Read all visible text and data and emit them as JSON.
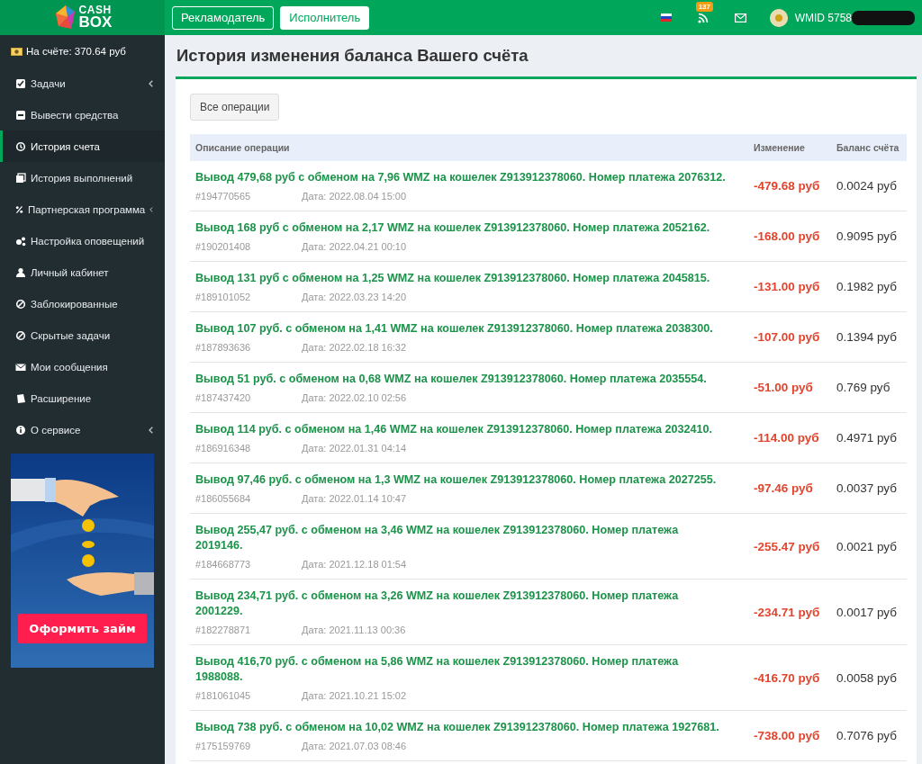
{
  "logo": {
    "line1": "CASH",
    "line2": "BOX"
  },
  "role_tabs": [
    {
      "label": "Рекламодатель",
      "selected": false
    },
    {
      "label": "Исполнитель",
      "selected": true
    }
  ],
  "topbar": {
    "notifications_count": "137",
    "user": "WMID 5758"
  },
  "sidebar": {
    "balance": "На счёте: 370.64 руб",
    "items": [
      {
        "label": "Задачи",
        "kind": "submenu",
        "selected": false
      },
      {
        "label": "Вывести средства",
        "kind": "link",
        "selected": false
      },
      {
        "label": "История счета",
        "kind": "link",
        "selected": true
      },
      {
        "label": "История выполнений",
        "kind": "link",
        "selected": false
      },
      {
        "label": "Партнерская программа",
        "kind": "submenu",
        "selected": false
      },
      {
        "label": "Настройка оповещений",
        "kind": "link",
        "selected": false
      },
      {
        "label": "Личный кабинет",
        "kind": "link",
        "selected": false
      },
      {
        "label": "Заблокированные",
        "kind": "link",
        "selected": false
      },
      {
        "label": "Скрытые задачи",
        "kind": "link",
        "selected": false
      },
      {
        "label": "Мои сообщения",
        "kind": "link",
        "selected": false
      },
      {
        "label": "Расширение",
        "kind": "link",
        "selected": false
      },
      {
        "label": "О сервисе",
        "kind": "submenu",
        "selected": false
      }
    ],
    "ad": {
      "button": "Оформить займ"
    }
  },
  "page_title": "История изменения баланса Вашего счёта",
  "filter_button": "Все операции",
  "table": {
    "columns": [
      "Описание операции",
      "Изменение",
      "Баланс счёта"
    ],
    "rows": [
      {
        "description": "Вывод 479,68 руб с обменом на 7,96 WMZ на кошелек Z913912378060. Номер платежа 2076312.",
        "id": "#194770565",
        "date": "Дата: 2022.08.04 15:00",
        "change": "-479.68 руб",
        "balance": "0.0024 руб"
      },
      {
        "description": "Вывод 168 руб с обменом на 2,17 WMZ на кошелек Z913912378060. Номер платежа 2052162.",
        "id": "#190201408",
        "date": "Дата: 2022.04.21 00:10",
        "change": "-168.00 руб",
        "balance": "0.9095 руб"
      },
      {
        "description": "Вывод 131 руб с обменом на 1,25 WMZ на кошелек Z913912378060. Номер платежа 2045815.",
        "id": "#189101052",
        "date": "Дата: 2022.03.23 14:20",
        "change": "-131.00 руб",
        "balance": "0.1982 руб"
      },
      {
        "description": "Вывод 107 руб. с обменом на 1,41 WMZ на кошелек Z913912378060. Номер платежа 2038300.",
        "id": "#187893636",
        "date": "Дата: 2022.02.18 16:32",
        "change": "-107.00 руб",
        "balance": "0.1394 руб"
      },
      {
        "description": "Вывод 51 руб. с обменом на 0,68 WMZ на кошелек Z913912378060. Номер платежа 2035554.",
        "id": "#187437420",
        "date": "Дата: 2022.02.10 02:56",
        "change": "-51.00 руб",
        "balance": "0.769 руб"
      },
      {
        "description": "Вывод 114 руб. с обменом на 1,46 WMZ на кошелек Z913912378060. Номер платежа 2032410.",
        "id": "#186916348",
        "date": "Дата: 2022.01.31 04:14",
        "change": "-114.00 руб",
        "balance": "0.4971 руб"
      },
      {
        "description": "Вывод 97,46 руб. с обменом на 1,3 WMZ на кошелек Z913912378060. Номер платежа 2027255.",
        "id": "#186055684",
        "date": "Дата: 2022.01.14 10:47",
        "change": "-97.46 руб",
        "balance": "0.0037 руб"
      },
      {
        "description": "Вывод 255,47 руб. с обменом на 3,46 WMZ на кошелек Z913912378060. Номер платежа 2019146.",
        "id": "#184668773",
        "date": "Дата: 2021.12.18 01:54",
        "change": "-255.47 руб",
        "balance": "0.0021 руб"
      },
      {
        "description": "Вывод 234,71 руб. с обменом на 3,26 WMZ на кошелек Z913912378060. Номер платежа 2001229.",
        "id": "#182278871",
        "date": "Дата: 2021.11.13 00:36",
        "change": "-234.71 руб",
        "balance": "0.0017 руб"
      },
      {
        "description": "Вывод 416,70 руб. с обменом на 5,86 WMZ на кошелек Z913912378060. Номер платежа 1988088.",
        "id": "#181061045",
        "date": "Дата: 2021.10.21 15:02",
        "change": "-416.70 руб",
        "balance": "0.0058 руб"
      },
      {
        "description": "Вывод 738 руб. с обменом на 10,02 WMZ на кошелек Z913912378060. Номер платежа 1927681.",
        "id": "#175159769",
        "date": "Дата: 2021.07.03 08:46",
        "change": "-738.00 руб",
        "balance": "0.7076 руб"
      }
    ]
  }
}
